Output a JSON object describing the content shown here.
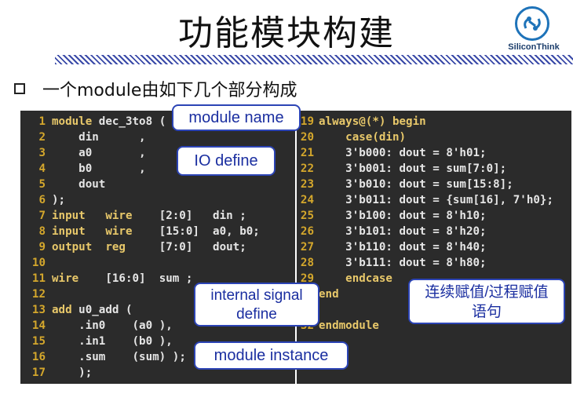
{
  "title": "功能模块构建",
  "logo": {
    "text": "SiliconThink"
  },
  "bullet": {
    "text": "一个module由如下几个部分构成"
  },
  "code_left": [
    {
      "num": "1",
      "text": "module dec_3to8 ("
    },
    {
      "num": "2",
      "text": "    din      ,"
    },
    {
      "num": "3",
      "text": "    a0       ,"
    },
    {
      "num": "4",
      "text": "    b0       ,"
    },
    {
      "num": "5",
      "text": "    dout"
    },
    {
      "num": "6",
      "text": ");"
    },
    {
      "num": "7",
      "text": "input   wire    [2:0]   din ;"
    },
    {
      "num": "8",
      "text": "input   wire    [15:0]  a0, b0;"
    },
    {
      "num": "9",
      "text": "output  reg     [7:0]   dout;"
    },
    {
      "num": "10",
      "text": ""
    },
    {
      "num": "11",
      "text": "wire    [16:0]  sum ;"
    },
    {
      "num": "12",
      "text": ""
    },
    {
      "num": "13",
      "text": "add u0_add ("
    },
    {
      "num": "14",
      "text": "    .in0    (a0 ),"
    },
    {
      "num": "15",
      "text": "    .in1    (b0 ),"
    },
    {
      "num": "16",
      "text": "    .sum    (sum) );"
    },
    {
      "num": "17",
      "text": "    );"
    }
  ],
  "code_right": [
    {
      "num": "19",
      "text": "always@(*) begin"
    },
    {
      "num": "20",
      "text": "    case(din)"
    },
    {
      "num": "21",
      "text": "    3'b000: dout = 8'h01;"
    },
    {
      "num": "22",
      "text": "    3'b001: dout = sum[7:0];"
    },
    {
      "num": "23",
      "text": "    3'b010: dout = sum[15:8];"
    },
    {
      "num": "24",
      "text": "    3'b011: dout = {sum[16], 7'h0};"
    },
    {
      "num": "25",
      "text": "    3'b100: dout = 8'h10;"
    },
    {
      "num": "26",
      "text": "    3'b101: dout = 8'h20;"
    },
    {
      "num": "27",
      "text": "    3'b110: dout = 8'h40;"
    },
    {
      "num": "28",
      "text": "    3'b111: dout = 8'h80;"
    },
    {
      "num": "29",
      "text": "    endcase"
    },
    {
      "num": "30",
      "text": "end"
    },
    {
      "num": "31",
      "text": ""
    },
    {
      "num": "32",
      "text": "endmodule"
    }
  ],
  "callouts": {
    "module_name": "module name",
    "io_define": "IO define",
    "internal_signal": "internal signal define",
    "module_instance": "module instance",
    "assign": "连续赋值/过程赋值语句"
  },
  "colors": {
    "code_bg": "#2b2b2b",
    "line_number": "#d4a72c",
    "keyword": "#e8c86a",
    "callout_border": "#2c44b5",
    "callout_text": "#1a2ea0"
  }
}
